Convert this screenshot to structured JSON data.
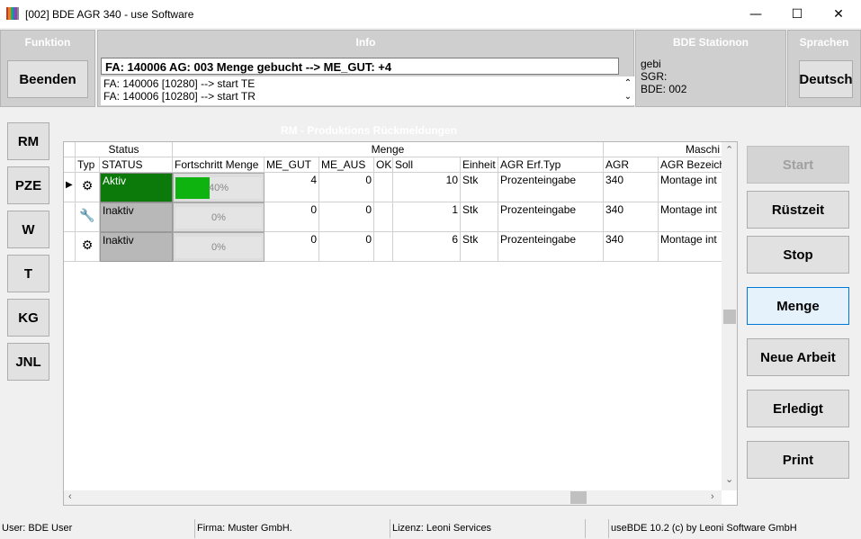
{
  "window": {
    "title": "[002] BDE AGR 340 - use Software",
    "minimize_glyph": "—",
    "maximize_glyph": "☐",
    "close_glyph": "✕"
  },
  "funktion": {
    "header": "Funktion",
    "beenden_label": "Beenden"
  },
  "info": {
    "header": "Info",
    "current": "FA: 140006 AG: 003 Menge gebucht --> ME_GUT: +4",
    "log": [
      "FA: 140006 [10280] --> start TE",
      "FA: 140006 [10280] --> start TR"
    ]
  },
  "station": {
    "header": "BDE Stationon",
    "lines": [
      "gebi",
      "SGR:",
      "BDE: 002"
    ]
  },
  "sprachen": {
    "header": "Sprachen",
    "language_label": "Deutsch"
  },
  "nav": [
    "RM",
    "PZE",
    "W",
    "T",
    "KG",
    "JNL"
  ],
  "center": {
    "header": "RM - Produktions Rückmeldungen"
  },
  "table": {
    "groups": {
      "status": "Status",
      "menge": "Menge",
      "maschine": "Maschi"
    },
    "columns": [
      "Typ",
      "STATUS",
      "Fortschritt Menge",
      "ME_GUT",
      "ME_AUS",
      "OK",
      "Soll",
      "Einheit",
      "AGR Erf.Typ",
      "AGR",
      "AGR Bezeich"
    ],
    "rows": [
      {
        "typ_icon": "gear-icon",
        "status": "Aktiv",
        "status_color": "#0b7a0b",
        "progress": 40,
        "progress_text": "40%",
        "me_gut": "4",
        "me_aus": "0",
        "ok": "",
        "soll": "10",
        "einheit": "Stk",
        "erf_typ": "Prozenteingabe",
        "agr": "340",
        "bezeich": "Montage int",
        "selected": true
      },
      {
        "typ_icon": "wrench-icon",
        "status": "Inaktiv",
        "status_color": "#b8b8b8",
        "progress": 0,
        "progress_text": "0%",
        "me_gut": "0",
        "me_aus": "0",
        "ok": "",
        "soll": "1",
        "einheit": "Stk",
        "erf_typ": "Prozenteingabe",
        "agr": "340",
        "bezeich": "Montage int",
        "selected": false
      },
      {
        "typ_icon": "gear-icon",
        "status": "Inaktiv",
        "status_color": "#b8b8b8",
        "progress": 0,
        "progress_text": "0%",
        "me_gut": "0",
        "me_aus": "0",
        "ok": "",
        "soll": "6",
        "einheit": "Stk",
        "erf_typ": "Prozenteingabe",
        "agr": "340",
        "bezeich": "Montage int",
        "selected": false
      }
    ]
  },
  "actions": {
    "start": "Start",
    "ruestzeit": "Rüstzeit",
    "stop": "Stop",
    "menge": "Menge",
    "neue_arbeit": "Neue Arbeit",
    "erledigt": "Erledigt",
    "print": "Print"
  },
  "statusbar": {
    "user": "User: BDE User",
    "firma": "Firma: Muster GmbH.",
    "lizenz": "Lizenz: Leoni Services",
    "extra": "",
    "version": "useBDE 10.2 (c) by Leoni Software GmbH"
  },
  "colors": {
    "progress_fill": "#0fb30f",
    "panel_bg": "#cfcfcf",
    "accent": "#0078d7"
  }
}
